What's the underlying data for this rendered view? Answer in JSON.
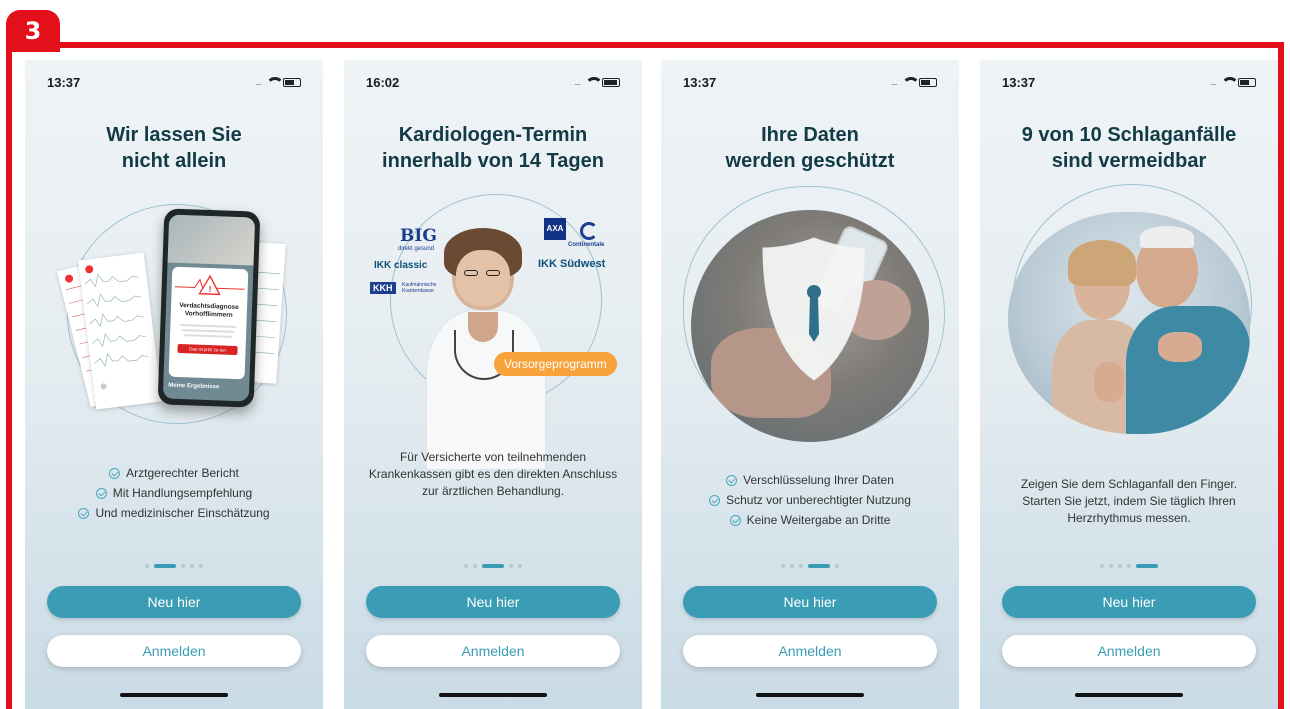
{
  "step": "3",
  "colors": {
    "accent": "#3a9db5",
    "frame": "#e3101b",
    "title": "#123b45",
    "orange": "#f7a23b"
  },
  "screens": [
    {
      "time": "13:37",
      "title_line1": "Wir lassen Sie",
      "title_line2": "nicht allein",
      "illustration": {
        "card_title": "Verdachtsdiagnose Vorhofflimmern",
        "card_button": "Das ist jetzt zu tun",
        "results_label": "Meine Ergebnisse"
      },
      "bullets": [
        "Arztgerechter Bericht",
        "Mit Handlungsempfehlung",
        "Und medizinischer Einschätzung"
      ],
      "active_page": 1,
      "primary_label": "Neu hier",
      "secondary_label": "Anmelden"
    },
    {
      "time": "16:02",
      "title_line1": "Kardiologen-Termin",
      "title_line2": "innerhalb von 14 Tagen",
      "logos": {
        "big": "BIG",
        "big_sub": "direkt gesund",
        "ikk_classic": "IKK classic",
        "kkh": "KKH",
        "kkh_sub": "Kaufmännische Krankenkasse",
        "axa": "AXA",
        "continentale": "Continentale",
        "ikk_sw": "IKK Südwest"
      },
      "badge": "Vorsorgeprogramm",
      "text": "Für Versicherte von teilnehmenden Krankenkassen gibt es den direkten Anschluss zur ärztlichen Behandlung.",
      "active_page": 2,
      "primary_label": "Neu hier",
      "secondary_label": "Anmelden"
    },
    {
      "time": "13:37",
      "title_line1": "Ihre Daten",
      "title_line2": "werden geschützt",
      "bullets": [
        "Verschlüsselung Ihrer Daten",
        "Schutz vor unberechtigter Nutzung",
        "Keine Weitergabe an Dritte"
      ],
      "active_page": 3,
      "primary_label": "Neu hier",
      "secondary_label": "Anmelden"
    },
    {
      "time": "13:37",
      "title_line1": "9 von 10 Schlaganfälle",
      "title_line2": "sind vermeidbar",
      "text": "Zeigen Sie dem Schlaganfall den Finger. Starten Sie jetzt, indem Sie täglich Ihren Herzrhythmus messen.",
      "active_page": 4,
      "primary_label": "Neu hier",
      "secondary_label": "Anmelden"
    }
  ]
}
